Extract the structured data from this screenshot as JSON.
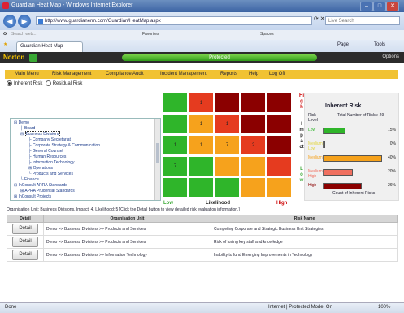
{
  "browser": {
    "title": "Guardian Heat Map - Windows Internet Explorer",
    "url": "http://www.guardianerm.com/Guardian/HeatMap.aspx",
    "search_placeholder": "Live Search",
    "search_toolbar_placeholder": "Search web...",
    "links": [
      "Favorites",
      "Spaces"
    ],
    "tab_label": "Guardian Heat Map",
    "tools_right": [
      "Page",
      "Tools"
    ],
    "norton_logo": "Norton",
    "norton_status": "Protected",
    "norton_options": "Options",
    "status_left": "Done",
    "status_zone": "Internet | Protected Mode: On",
    "zoom": "100%"
  },
  "menu": {
    "items": [
      "Main Menu",
      "Risk Management",
      "Compliance Audit",
      "Incident Management",
      "Reports",
      "Help",
      "Log Off"
    ]
  },
  "risk_toggle": {
    "inherent": "Inherent Risk",
    "residual": "Residual Risk",
    "selected": "inherent"
  },
  "tree": [
    "Demo",
    "Board",
    "Business Divisions",
    "Company Secretariat",
    "Corporate Strategy & Communication",
    "General Counsel",
    "Human Resources",
    "Information Technology",
    "Operations",
    "Products and Services",
    "Finance",
    "InConsult ARRA Standards",
    "APRA Prudential Standards",
    "InConsult Projects"
  ],
  "heatmap": {
    "x_low": "Low",
    "x_label": "Likelihood",
    "x_high": "High",
    "y_label": "Impact",
    "y_high": "High",
    "y_low": "Low",
    "rows": [
      [
        {
          "c": "#2fb52a",
          "v": ""
        },
        {
          "c": "#e53b1f",
          "v": "1"
        },
        {
          "c": "#8b0000",
          "v": ""
        },
        {
          "c": "#8b0000",
          "v": ""
        },
        {
          "c": "#8b0000",
          "v": ""
        }
      ],
      [
        {
          "c": "#2fb52a",
          "v": ""
        },
        {
          "c": "#f6a21c",
          "v": "1"
        },
        {
          "c": "#e53b1f",
          "v": "1"
        },
        {
          "c": "#8b0000",
          "v": ""
        },
        {
          "c": "#8b0000",
          "v": ""
        }
      ],
      [
        {
          "c": "#2fb52a",
          "v": "1"
        },
        {
          "c": "#f6a21c",
          "v": "1"
        },
        {
          "c": "#f6a21c",
          "v": "7"
        },
        {
          "c": "#e53b1f",
          "v": "2"
        },
        {
          "c": "#8b0000",
          "v": ""
        }
      ],
      [
        {
          "c": "#2fb52a",
          "v": "7"
        },
        {
          "c": "#2fb52a",
          "v": ""
        },
        {
          "c": "#f6a21c",
          "v": ""
        },
        {
          "c": "#f6a21c",
          "v": ""
        },
        {
          "c": "#e53b1f",
          "v": ""
        }
      ],
      [
        {
          "c": "#2fb52a",
          "v": ""
        },
        {
          "c": "#2fb52a",
          "v": ""
        },
        {
          "c": "#2fb52a",
          "v": ""
        },
        {
          "c": "#f6a21c",
          "v": ""
        },
        {
          "c": "#f6a21c",
          "v": ""
        }
      ]
    ]
  },
  "inherent_panel": {
    "title": "Inherent Risk",
    "total": "Total Number of Risks: 29",
    "level_label": "Risk Level",
    "caption": "Count of Inherent Risks",
    "bars": [
      {
        "label": "Low",
        "color": "#2fb52a",
        "pct": 15,
        "text": "15%"
      },
      {
        "label": "Medium Low",
        "color": "#e2d53d",
        "pct": 0,
        "text": "0%"
      },
      {
        "label": "Medium",
        "color": "#f6a21c",
        "pct": 40,
        "text": "40%"
      },
      {
        "label": "Medium High",
        "color": "#f07060",
        "pct": 20,
        "text": "20%"
      },
      {
        "label": "High",
        "color": "#8b0000",
        "pct": 26,
        "text": "26%"
      }
    ]
  },
  "info_line": "Organisation Unit: Business Divisions. Impact: 4, Likelihood: 5 [Click the Detail button to view detailed risk evaluation information.]",
  "table": {
    "headers": [
      "Detail",
      "Organisation Unit",
      "Risk Name"
    ],
    "button_label": "Detail",
    "rows": [
      {
        "unit": "Demo >> Business Divisions >> Products and Services",
        "risk": "Competing Corporate and Strategic Business Unit Strategies"
      },
      {
        "unit": "Demo >> Business Divisions >> Products and Services",
        "risk": "Risk of losing key staff and knowledge"
      },
      {
        "unit": "Demo >> Business Divisions >> Information Technology",
        "risk": "Inability to fund Emerging Improvements in Technology"
      }
    ]
  }
}
